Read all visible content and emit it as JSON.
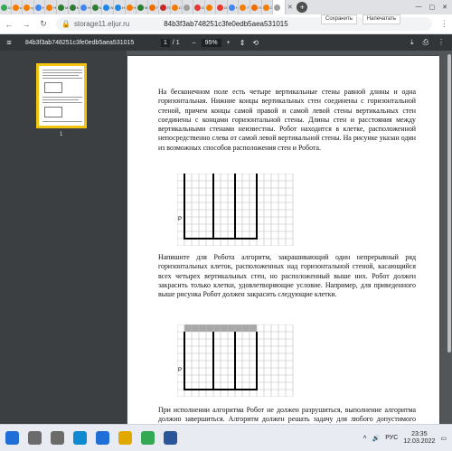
{
  "tabs": [
    {
      "label": "Go",
      "color": "#34a853"
    },
    {
      "label": "sg",
      "color": "#f57c00"
    },
    {
      "label": "гр",
      "color": "#f57c00"
    },
    {
      "label": "Н",
      "color": "#4285f4"
    },
    {
      "label": "Н",
      "color": "#f57c00"
    },
    {
      "label": "M",
      "color": "#2e7d32"
    },
    {
      "label": "M",
      "color": "#2e7d32"
    },
    {
      "label": "Н",
      "color": "#4285f4"
    },
    {
      "label": "M",
      "color": "#2e7d32"
    },
    {
      "label": "N",
      "color": "#1e88e5"
    },
    {
      "label": "Н",
      "color": "#1e88e5"
    },
    {
      "label": "Н",
      "color": "#f57c00"
    },
    {
      "label": "М",
      "color": "#2e7d32"
    },
    {
      "label": "Г",
      "color": "#ef6c00"
    },
    {
      "label": "Ге",
      "color": "#c62828"
    },
    {
      "label": "Ce",
      "color": "#f57c00"
    },
    {
      "label": "",
      "color": "#9e9e9e"
    },
    {
      "label": "Di",
      "color": "#e53935"
    },
    {
      "label": "",
      "color": "#f57c00"
    },
    {
      "label": "Di",
      "color": "#e53935"
    },
    {
      "label": "Н",
      "color": "#4285f4"
    },
    {
      "label": "Г",
      "color": "#f57c00"
    },
    {
      "label": "Ге",
      "color": "#ef6c00"
    },
    {
      "label": "Ce",
      "color": "#f57c00"
    }
  ],
  "address": {
    "host": "storage11.eljur.ru",
    "doc_title": "84b3f3ab748251c3fe0edb5aea531015"
  },
  "actions": {
    "save_label": "Сохранить",
    "print_label": "Напечатать"
  },
  "pdf_toolbar": {
    "title": "84b3f3ab748251c3fe0edb5aea531015",
    "current_page": "1",
    "total_pages": "/ 1",
    "zoom_minus": "–",
    "zoom": "95%",
    "zoom_plus": "+"
  },
  "thumbnail": {
    "number": "1"
  },
  "document": {
    "paragraph1": "На бесконечном поле есть четыре вертикальные стены равной длины и одна горизонтальная. Нижние концы вертикальных стен соединены с горизонтальной стеной, причем концы самой правой и самой левой стены вертикальных стен соединены с концами горизонтальной стены. Длины стен и расстояния между вертикальными стенами неизвестны. Робот находится в клетке, расположенной непосредственно слева от самой левой вертикальной стены. На рисунке указан один из возможных способов расположения стен и Робота.",
    "robot_marker": "Р",
    "paragraph2": "Напишите для Робота алгоритм, закрашивающий один непрерывный ряд горизонтальных клеток, расположенных над горизонтальной стеной, касающийся всех четырех вертикальных стен, но расположенный выше них. Робот должен закрасить только клетки, удовлетворяющие условие. Например, для приведенного выше рисунка Робот должен закрасить следующие клетки.",
    "robot_marker2": "Р",
    "paragraph3": "При исполнении алгоритма Робот не должен разрушиться, выполнение алгоритма должно завершиться. Алгоритм должен решать задачу для любого допустимого расположения стен"
  },
  "taskbar": {
    "icons": [
      {
        "name": "start",
        "color": "#1f6fd6"
      },
      {
        "name": "search",
        "color": "#6b6b6b"
      },
      {
        "name": "task-view",
        "color": "#6b6b6b"
      },
      {
        "name": "edge",
        "color": "#0f8ad1"
      },
      {
        "name": "store",
        "color": "#1f6fd6"
      },
      {
        "name": "files",
        "color": "#e0a800"
      },
      {
        "name": "chrome",
        "color": "#34a853"
      },
      {
        "name": "word",
        "color": "#2b579a"
      }
    ],
    "lang": "РУС",
    "time": "23:35",
    "date": "12.03.2022"
  }
}
